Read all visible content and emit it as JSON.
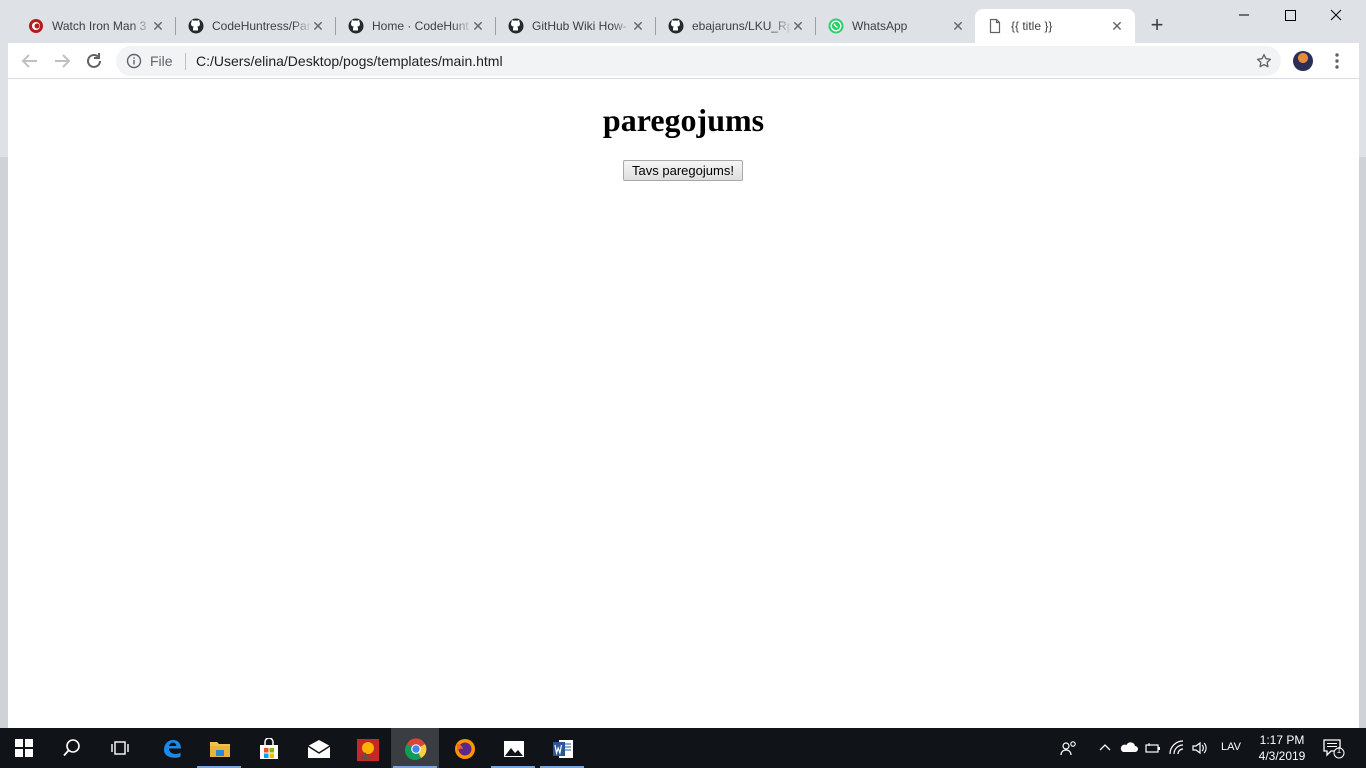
{
  "browser": {
    "tabs": [
      {
        "title": "Watch Iron Man 3",
        "icon": "streaming-site-icon"
      },
      {
        "title": "CodeHuntress/Par",
        "icon": "github-icon"
      },
      {
        "title": "Home · CodeHunt",
        "icon": "github-icon"
      },
      {
        "title": "GitHub Wiki How-",
        "icon": "github-icon"
      },
      {
        "title": "ebajaruns/LKU_Rp",
        "icon": "github-icon"
      },
      {
        "title": "WhatsApp",
        "icon": "whatsapp-icon"
      },
      {
        "title": "{{ title }}",
        "icon": "page-icon",
        "active": true
      }
    ],
    "address": {
      "scheme": "File",
      "url": "C:/Users/elina/Desktop/pogs/templates/main.html"
    }
  },
  "page": {
    "heading": "paregojums",
    "button_label": "Tavs paregojums!"
  },
  "taskbar": {
    "language": "LAV",
    "time": "1:17 PM",
    "date": "4/3/2019",
    "notification_count": "1"
  }
}
